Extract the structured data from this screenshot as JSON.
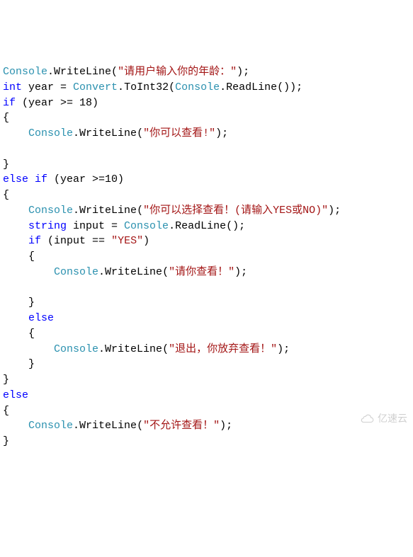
{
  "chart_data": {
    "type": "table",
    "title": "C# code snippet — age check with nested if/else",
    "language": "csharp",
    "lines": [
      {
        "tokens": [
          {
            "t": "Console",
            "c": "type"
          },
          {
            "t": ".",
            "c": "punct"
          },
          {
            "t": "WriteLine",
            "c": "ident"
          },
          {
            "t": "(",
            "c": "punct"
          },
          {
            "t": "\"请用户输入你的年龄：\"",
            "c": "str"
          },
          {
            "t": ");",
            "c": "punct"
          }
        ],
        "indent": 0
      },
      {
        "tokens": [
          {
            "t": "int",
            "c": "kw"
          },
          {
            "t": " year = ",
            "c": "ident"
          },
          {
            "t": "Convert",
            "c": "type"
          },
          {
            "t": ".",
            "c": "punct"
          },
          {
            "t": "ToInt32",
            "c": "ident"
          },
          {
            "t": "(",
            "c": "punct"
          },
          {
            "t": "Console",
            "c": "type"
          },
          {
            "t": ".",
            "c": "punct"
          },
          {
            "t": "ReadLine",
            "c": "ident"
          },
          {
            "t": "());",
            "c": "punct"
          }
        ],
        "indent": 0
      },
      {
        "tokens": [
          {
            "t": "if",
            "c": "kw"
          },
          {
            "t": " (year >= 18)",
            "c": "ident"
          }
        ],
        "indent": 0
      },
      {
        "tokens": [
          {
            "t": "{",
            "c": "punct"
          }
        ],
        "indent": 0
      },
      {
        "tokens": [
          {
            "t": "Console",
            "c": "type"
          },
          {
            "t": ".",
            "c": "punct"
          },
          {
            "t": "WriteLine",
            "c": "ident"
          },
          {
            "t": "(",
            "c": "punct"
          },
          {
            "t": "\"你可以查看!\"",
            "c": "str"
          },
          {
            "t": ");",
            "c": "punct"
          }
        ],
        "indent": 1
      },
      {
        "tokens": [],
        "indent": 0
      },
      {
        "tokens": [
          {
            "t": "}",
            "c": "punct"
          }
        ],
        "indent": 0
      },
      {
        "tokens": [
          {
            "t": "else if",
            "c": "kw"
          },
          {
            "t": " (year >=10)",
            "c": "ident"
          }
        ],
        "indent": 0
      },
      {
        "tokens": [
          {
            "t": "{",
            "c": "punct"
          }
        ],
        "indent": 0
      },
      {
        "tokens": [
          {
            "t": "Console",
            "c": "type"
          },
          {
            "t": ".",
            "c": "punct"
          },
          {
            "t": "WriteLine",
            "c": "ident"
          },
          {
            "t": "(",
            "c": "punct"
          },
          {
            "t": "\"你可以选择查看！(请输入YES或NO)\"",
            "c": "str"
          },
          {
            "t": ");",
            "c": "punct"
          }
        ],
        "indent": 1
      },
      {
        "tokens": [
          {
            "t": "string",
            "c": "kw"
          },
          {
            "t": " input = ",
            "c": "ident"
          },
          {
            "t": "Console",
            "c": "type"
          },
          {
            "t": ".",
            "c": "punct"
          },
          {
            "t": "ReadLine",
            "c": "ident"
          },
          {
            "t": "();",
            "c": "punct"
          }
        ],
        "indent": 1
      },
      {
        "tokens": [
          {
            "t": "if",
            "c": "kw"
          },
          {
            "t": " (input == ",
            "c": "ident"
          },
          {
            "t": "\"YES\"",
            "c": "str"
          },
          {
            "t": ")",
            "c": "punct"
          }
        ],
        "indent": 1
      },
      {
        "tokens": [
          {
            "t": "{",
            "c": "punct"
          }
        ],
        "indent": 1
      },
      {
        "tokens": [
          {
            "t": "Console",
            "c": "type"
          },
          {
            "t": ".",
            "c": "punct"
          },
          {
            "t": "WriteLine",
            "c": "ident"
          },
          {
            "t": "(",
            "c": "punct"
          },
          {
            "t": "\"请你查看！\"",
            "c": "str"
          },
          {
            "t": ");",
            "c": "punct"
          }
        ],
        "indent": 2
      },
      {
        "tokens": [],
        "indent": 0
      },
      {
        "tokens": [
          {
            "t": "}",
            "c": "punct"
          }
        ],
        "indent": 1
      },
      {
        "tokens": [
          {
            "t": "else",
            "c": "kw"
          }
        ],
        "indent": 1
      },
      {
        "tokens": [
          {
            "t": "{",
            "c": "punct"
          }
        ],
        "indent": 1
      },
      {
        "tokens": [
          {
            "t": "Console",
            "c": "type"
          },
          {
            "t": ".",
            "c": "punct"
          },
          {
            "t": "WriteLine",
            "c": "ident"
          },
          {
            "t": "(",
            "c": "punct"
          },
          {
            "t": "\"退出，你放弃查看！\"",
            "c": "str"
          },
          {
            "t": ");",
            "c": "punct"
          }
        ],
        "indent": 2
      },
      {
        "tokens": [
          {
            "t": "}",
            "c": "punct"
          }
        ],
        "indent": 1
      },
      {
        "tokens": [
          {
            "t": "}",
            "c": "punct"
          }
        ],
        "indent": 0
      },
      {
        "tokens": [
          {
            "t": "else",
            "c": "kw"
          }
        ],
        "indent": 0
      },
      {
        "tokens": [
          {
            "t": "{",
            "c": "punct"
          }
        ],
        "indent": 0
      },
      {
        "tokens": [
          {
            "t": "Console",
            "c": "type"
          },
          {
            "t": ".",
            "c": "punct"
          },
          {
            "t": "WriteLine",
            "c": "ident"
          },
          {
            "t": "(",
            "c": "punct"
          },
          {
            "t": "\"不允许查看！\"",
            "c": "str"
          },
          {
            "t": ");",
            "c": "punct"
          }
        ],
        "indent": 1
      },
      {
        "tokens": [
          {
            "t": "}",
            "c": "punct"
          }
        ],
        "indent": 0
      }
    ]
  },
  "watermark": "亿速云"
}
